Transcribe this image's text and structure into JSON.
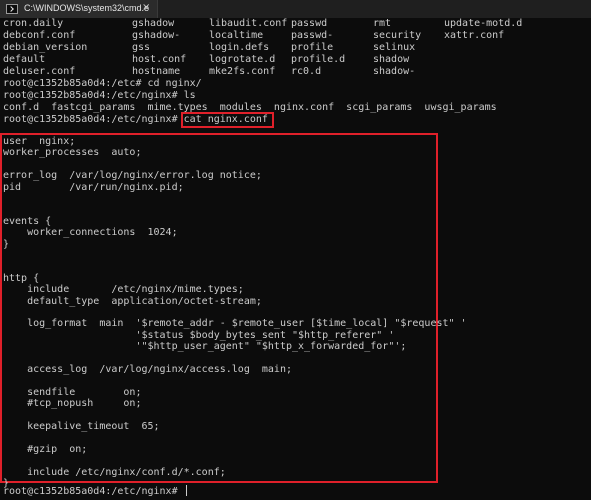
{
  "window": {
    "tab_title": "C:\\WINDOWS\\system32\\cmd.e",
    "close_glyph": "×"
  },
  "terminal": {
    "etc_listing": [
      [
        "cron.daily",
        "gshadow",
        "libaudit.conf",
        "passwd",
        "rmt",
        "update-motd.d"
      ],
      [
        "debconf.conf",
        "gshadow-",
        "localtime",
        "passwd-",
        "security",
        "xattr.conf"
      ],
      [
        "debian_version",
        "gss",
        "login.defs",
        "profile",
        "selinux",
        ""
      ],
      [
        "default",
        "host.conf",
        "logrotate.d",
        "profile.d",
        "shadow",
        ""
      ],
      [
        "deluser.conf",
        "hostname",
        "mke2fs.conf",
        "rc0.d",
        "shadow-",
        ""
      ]
    ],
    "prompt_cd": "root@c1352b85a0d4:/etc# cd nginx/",
    "prompt_ls": "root@c1352b85a0d4:/etc/nginx# ls",
    "ls_output": "conf.d  fastcgi_params  mime.types  modules  nginx.conf  scgi_params  uwsgi_params",
    "prompt_cat_prefix": "root@c1352b85a0d4:/etc/nginx# cat ",
    "cat_target": "nginx.conf",
    "config_lines": [
      "user  nginx;",
      "worker_processes  auto;",
      "",
      "error_log  /var/log/nginx/error.log notice;",
      "pid        /var/run/nginx.pid;",
      "",
      "",
      "events {",
      "    worker_connections  1024;",
      "}",
      "",
      "",
      "http {",
      "    include       /etc/nginx/mime.types;",
      "    default_type  application/octet-stream;",
      "",
      "    log_format  main  '$remote_addr - $remote_user [$time_local] \"$request\" '",
      "                      '$status $body_bytes_sent \"$http_referer\" '",
      "                      '\"$http_user_agent\" \"$http_x_forwarded_for\"';",
      "",
      "    access_log  /var/log/nginx/access.log  main;",
      "",
      "    sendfile        on;",
      "    #tcp_nopush     on;",
      "",
      "    keepalive_timeout  65;",
      "",
      "    #gzip  on;",
      "",
      "    include /etc/nginx/conf.d/*.conf;",
      "}"
    ],
    "final_prompt": "root@c1352b85a0d4:/etc/nginx# ",
    "highlight_color": "#e0202a",
    "text_color": "#cccccc",
    "background_color": "#0c0c0c"
  }
}
